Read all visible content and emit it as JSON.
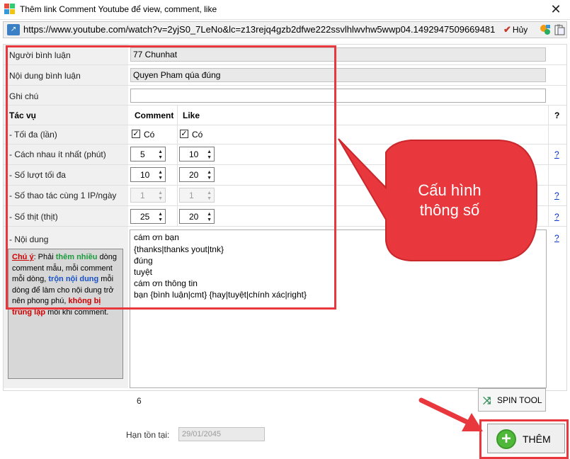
{
  "window": {
    "title": "Thêm link Comment Youtube để view, comment, like",
    "close_glyph": "✕"
  },
  "urlbar": {
    "url": "https://www.youtube.com/watch?v=2yjS0_7LeNo&lc=z13rejq4gzb2dfwe222ssvlhlwvhw5wwp04.1492947509669481",
    "cancel_label": "Hủy",
    "icons": [
      "link-icon",
      "checkmark-icon",
      "config-icon",
      "clipboard-icon"
    ]
  },
  "form": {
    "commenter_label": "Người bình luận",
    "commenter_value": "77 Chunhat",
    "content_label": "Nội dung bình luận",
    "content_value": "Quyen Pham qúa đúng",
    "note_label": "Ghi chú",
    "note_value": "",
    "task_header": "Tác vụ",
    "comment_header": "Comment",
    "like_header": "Like",
    "help_header": "?",
    "rows": [
      {
        "label": " - Tối đa (lần)",
        "type": "checkbox",
        "comment_checked": true,
        "comment_text": "Có",
        "like_checked": true,
        "like_text": "Có",
        "help": ""
      },
      {
        "label": " - Cách nhau ít nhất (phút)",
        "type": "spin",
        "comment": "5",
        "like": "10",
        "help": "?",
        "disabled": false
      },
      {
        "label": " - Số lượt tối đa",
        "type": "spin",
        "comment": "10",
        "like": "20",
        "help": "",
        "disabled": false
      },
      {
        "label": " - Số thao tác cùng 1 IP/ngày",
        "type": "spin",
        "comment": "1",
        "like": "1",
        "help": "?",
        "disabled": true
      },
      {
        "label": " - Số thịt (thịt)",
        "type": "spin",
        "comment": "25",
        "like": "20",
        "help": "?",
        "disabled": false
      }
    ],
    "content_row_label": " - Nội dung",
    "content_help": "?",
    "content_lines": [
      "cám ơn bạn",
      "{thanks|thanks yout|tnk}",
      "đúng",
      "tuyệt",
      "cám ơn thông tin",
      "bạn {bình luận|cmt} {hay|tuyệt|chính xác|right}"
    ],
    "content_count": "6",
    "spin_tool_label": "SPIN TOOL",
    "expire_label": "Hạn tồn tại:",
    "expire_value": "29/01/2045",
    "add_label": "THÊM"
  },
  "note_box": {
    "warn": "Chú ý",
    "t1": ": Phải ",
    "g1": "thêm nhiều",
    "t2": " dòng comment mẫu, mỗi comment mỗi dòng, ",
    "b1": "trộn nội dung",
    "t3": " mỗi dòng để làm cho nội dung trở nên phong phú, ",
    "r1": "không bị trùng lặp",
    "t4": " mỗi khi comment."
  },
  "annotation": {
    "callout_line1": "Cấu hình",
    "callout_line2": "thông số",
    "color": "#e8383d"
  }
}
